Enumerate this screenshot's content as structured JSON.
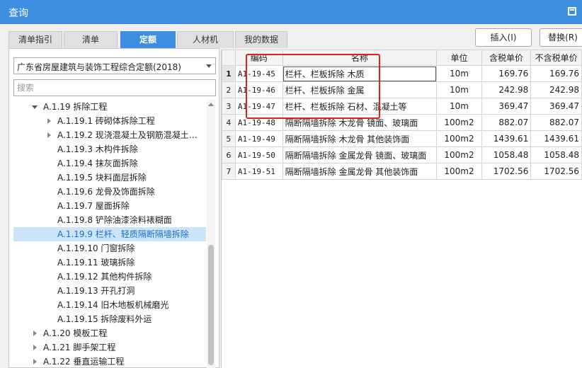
{
  "window": {
    "title": "查询"
  },
  "tabs": [
    {
      "label": "清单指引",
      "active": false
    },
    {
      "label": "清单",
      "active": false
    },
    {
      "label": "定额",
      "active": true
    },
    {
      "label": "人材机",
      "active": false
    },
    {
      "label": "我的数据",
      "active": false
    }
  ],
  "toolbar": {
    "insert_label": "插入(I)",
    "replace_label": "替换(R)"
  },
  "library": {
    "selected": "广东省房屋建筑与装饰工程综合定额(2018)"
  },
  "search": {
    "placeholder": "搜索"
  },
  "tree": [
    {
      "label": "A.1.19 拆除工程",
      "state": "open",
      "level": 1
    },
    {
      "label": "A.1.19.1 砖砌体拆除工程",
      "state": "closed",
      "level": 2
    },
    {
      "label": "A.1.19.2 现浇混凝土及钢筋混凝土…",
      "state": "closed",
      "level": 2
    },
    {
      "label": "A.1.19.3 木构件拆除",
      "state": "leaf",
      "level": 2
    },
    {
      "label": "A.1.19.4 抹灰面拆除",
      "state": "leaf",
      "level": 2
    },
    {
      "label": "A.1.19.5 块料面层拆除",
      "state": "leaf",
      "level": 2
    },
    {
      "label": "A.1.19.6 龙骨及饰面拆除",
      "state": "leaf",
      "level": 2
    },
    {
      "label": "A.1.19.7 屋面拆除",
      "state": "leaf",
      "level": 2
    },
    {
      "label": "A.1.19.8 铲除油漆涂料裱糊面",
      "state": "leaf",
      "level": 2
    },
    {
      "label": "A.1.19.9 栏杆、轻质隔断隔墙拆除",
      "state": "leaf",
      "level": 2,
      "selected": true
    },
    {
      "label": "A.1.19.10 门窗拆除",
      "state": "leaf",
      "level": 2
    },
    {
      "label": "A.1.19.11 玻璃拆除",
      "state": "leaf",
      "level": 2
    },
    {
      "label": "A.1.19.12 其他构件拆除",
      "state": "leaf",
      "level": 2
    },
    {
      "label": "A.1.19.13 开孔打洞",
      "state": "leaf",
      "level": 2
    },
    {
      "label": "A.1.19.14 旧木地板机械磨光",
      "state": "leaf",
      "level": 2
    },
    {
      "label": "A.1.19.15 拆除废料外运",
      "state": "leaf",
      "level": 2
    },
    {
      "label": "A.1.20 模板工程",
      "state": "closed",
      "level": 1
    },
    {
      "label": "A.1.21 脚手架工程",
      "state": "closed",
      "level": 1
    },
    {
      "label": "A.1.22 垂直运输工程",
      "state": "closed",
      "level": 1
    }
  ],
  "grid": {
    "columns": [
      "编码",
      "名称",
      "单位",
      "含税单价",
      "不含税单价"
    ],
    "rows": [
      {
        "n": "1",
        "code": "A1-19-45",
        "name": "栏杆、栏板拆除 木质",
        "unit": "10m",
        "price_tax": "169.76",
        "price_notax": "169.76"
      },
      {
        "n": "2",
        "code": "A1-19-46",
        "name": "栏杆、栏板拆除 金属",
        "unit": "10m",
        "price_tax": "242.98",
        "price_notax": "242.98"
      },
      {
        "n": "3",
        "code": "A1-19-47",
        "name": "栏杆、栏板拆除 石材、混凝土等",
        "unit": "10m",
        "price_tax": "369.47",
        "price_notax": "369.47"
      },
      {
        "n": "4",
        "code": "A1-19-48",
        "name": "隔断隔墙拆除 木龙骨 镜面、玻璃面",
        "unit": "100m2",
        "price_tax": "882.07",
        "price_notax": "882.07"
      },
      {
        "n": "5",
        "code": "A1-19-49",
        "name": "隔断隔墙拆除 木龙骨 其他装饰面",
        "unit": "100m2",
        "price_tax": "1439.61",
        "price_notax": "1439.61"
      },
      {
        "n": "6",
        "code": "A1-19-50",
        "name": "隔断隔墙拆除 金属龙骨 镜面、玻璃面",
        "unit": "100m2",
        "price_tax": "1058.48",
        "price_notax": "1058.48"
      },
      {
        "n": "7",
        "code": "A1-19-51",
        "name": "隔断隔墙拆除 金属龙骨 其他装饰面",
        "unit": "100m2",
        "price_tax": "1702.56",
        "price_notax": "1702.56"
      }
    ]
  },
  "colors": {
    "accent": "#3d8ee0",
    "selected_bg": "#cce4f7",
    "highlight_box": "#e02020"
  }
}
